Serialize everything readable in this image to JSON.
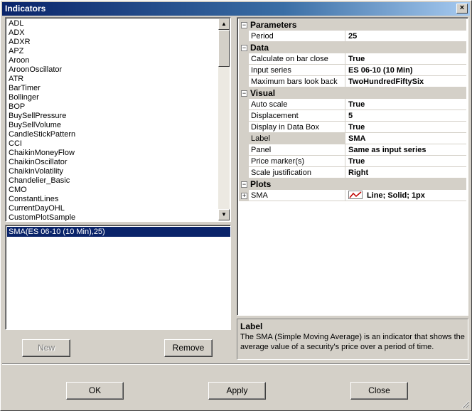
{
  "window": {
    "title": "Indicators",
    "close_label": "×"
  },
  "indicator_list": {
    "items": [
      "ADL",
      "ADX",
      "ADXR",
      "APZ",
      "Aroon",
      "AroonOscillator",
      "ATR",
      "BarTimer",
      "Bollinger",
      "BOP",
      "BuySellPressure",
      "BuySellVolume",
      "CandleStickPattern",
      "CCI",
      "ChaikinMoneyFlow",
      "ChaikinOscillator",
      "ChaikinVolatility",
      "Chandelier_Basic",
      "CMO",
      "ConstantLines",
      "CurrentDayOHL",
      "CustomPlotSample"
    ]
  },
  "applied_list": {
    "items": [
      "SMA(ES 06-10 (10 Min),25)"
    ]
  },
  "buttons": {
    "new": "New",
    "remove": "Remove",
    "ok": "OK",
    "apply": "Apply",
    "close": "Close"
  },
  "properties": {
    "parameters": {
      "title": "Parameters",
      "rows": [
        {
          "name": "Period",
          "value": "25"
        }
      ]
    },
    "data": {
      "title": "Data",
      "rows": [
        {
          "name": "Calculate on bar close",
          "value": "True"
        },
        {
          "name": "Input series",
          "value": "ES 06-10 (10 Min)"
        },
        {
          "name": "Maximum bars look back",
          "value": "TwoHundredFiftySix"
        }
      ]
    },
    "visual": {
      "title": "Visual",
      "rows": [
        {
          "name": "Auto scale",
          "value": "True"
        },
        {
          "name": "Displacement",
          "value": "5"
        },
        {
          "name": "Display in Data Box",
          "value": "True"
        },
        {
          "name": "Label",
          "value": "SMA"
        },
        {
          "name": "Panel",
          "value": "Same as input series"
        },
        {
          "name": "Price marker(s)",
          "value": "True"
        },
        {
          "name": "Scale justification",
          "value": "Right"
        }
      ]
    },
    "plots": {
      "title": "Plots",
      "rows": [
        {
          "name": "SMA",
          "value": "Line; Solid; 1px"
        }
      ]
    }
  },
  "description": {
    "title": "Label",
    "text": "The SMA (Simple Moving Average) is an indicator that shows the average value of a security's price over a period of time."
  },
  "colors": {
    "selection": "#0a246a",
    "plot_line": "#c00000"
  }
}
